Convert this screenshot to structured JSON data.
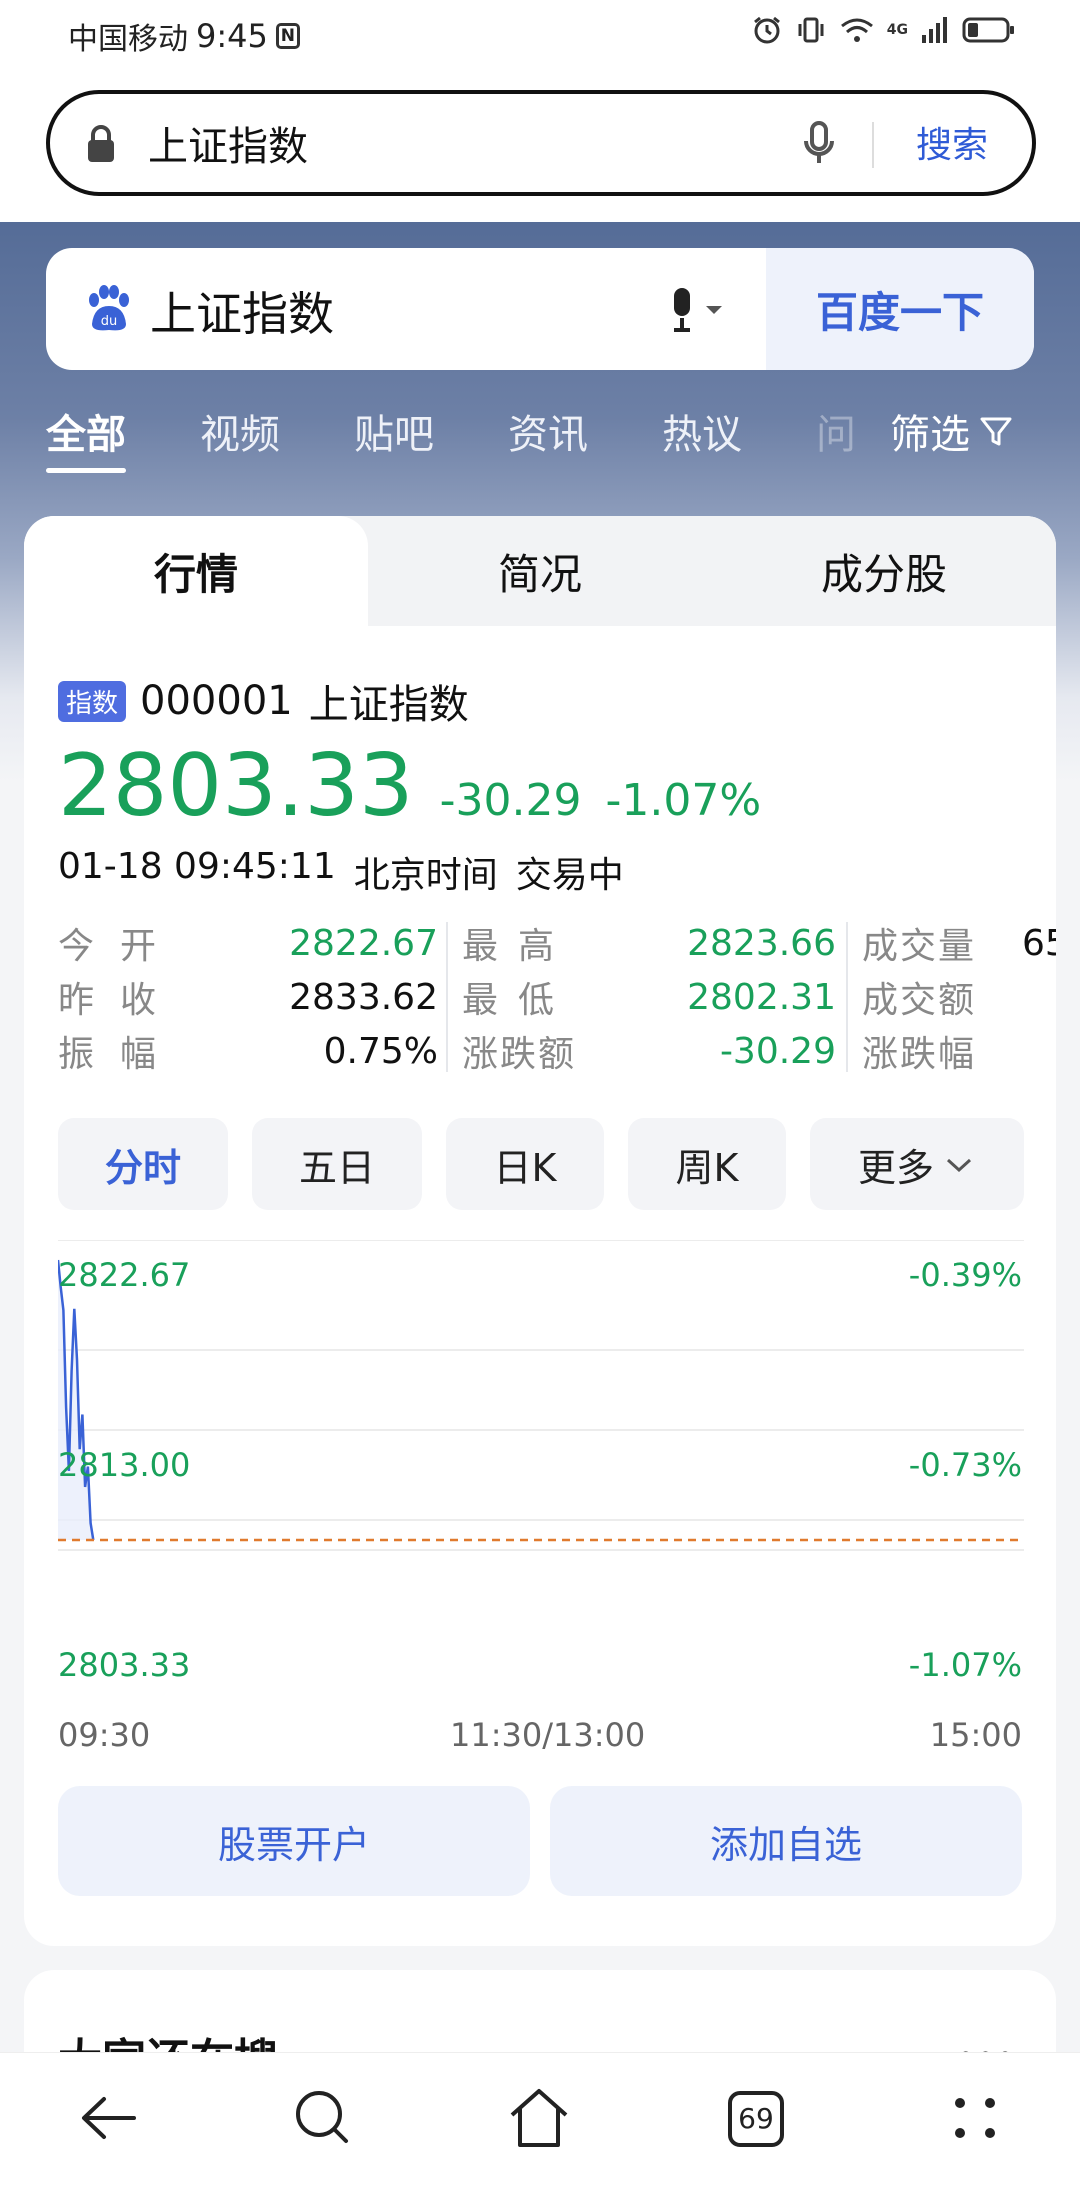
{
  "status_bar": {
    "carrier": "中国移动",
    "time": "9:45",
    "nfc": "N",
    "network": "4G"
  },
  "address_bar": {
    "query": "上证指数",
    "search_label": "搜索"
  },
  "baidu_search": {
    "query": "上证指数",
    "button_label": "百度一下"
  },
  "nav_tabs": [
    {
      "label": "全部",
      "active": true
    },
    {
      "label": "视频"
    },
    {
      "label": "贴吧"
    },
    {
      "label": "资讯"
    },
    {
      "label": "热议"
    },
    {
      "label": "问"
    }
  ],
  "filter_label": "筛选",
  "card_tabs": [
    "行情",
    "简况",
    "成分股"
  ],
  "stock": {
    "badge": "指数",
    "code": "000001",
    "name": "上证指数",
    "price": "2803.33",
    "change": "-30.29",
    "change_pct": "-1.07%",
    "date_time": "01-18 09:45:11",
    "timezone": "北京时间",
    "status": "交易中"
  },
  "stats": {
    "col1": [
      {
        "label": "今开",
        "value": "2822.67",
        "green": true
      },
      {
        "label": "昨收",
        "value": "2833.62",
        "green": false
      },
      {
        "label": "振幅",
        "value": "0.75%",
        "green": false
      }
    ],
    "col2": [
      {
        "label": "最高",
        "value": "2823.66",
        "green": true
      },
      {
        "label": "最低",
        "value": "2802.31",
        "green": true
      },
      {
        "label": "涨跌额",
        "value": "-30.29",
        "green": true
      }
    ],
    "col3": [
      {
        "label": "成交量",
        "value": "65"
      },
      {
        "label": "成交额",
        "value": ""
      },
      {
        "label": "涨跌幅",
        "value": ""
      }
    ]
  },
  "period_tabs": [
    {
      "label": "分时",
      "active": true
    },
    {
      "label": "五日"
    },
    {
      "label": "日K"
    },
    {
      "label": "周K"
    },
    {
      "label": "更多"
    }
  ],
  "chart_data": {
    "type": "line",
    "y_left_labels": [
      "2822.67",
      "2813.00",
      "2803.33"
    ],
    "y_right_labels": [
      "-0.39%",
      "-0.73%",
      "-1.07%"
    ],
    "x_labels": [
      "09:30",
      "11:30/13:00",
      "15:00"
    ],
    "ylim": [
      2803.33,
      2822.67
    ],
    "reference_value": 2803.33,
    "series": [
      {
        "values": [
          2822.67,
          2820.8,
          2819.2,
          2812.5,
          2808.1,
          2815.0,
          2819.3,
          2815.8,
          2809.6,
          2812.0,
          2807.0,
          2808.4,
          2804.5,
          2803.33
        ]
      }
    ],
    "colors": {
      "line": "#3a62d6",
      "fill": "#e8eefb",
      "reference": "#e07a2e",
      "axis_text": "#19a05a"
    }
  },
  "actions": {
    "open_account": "股票开户",
    "add_watchlist": "添加自选"
  },
  "next_section_title": "大家还在搜",
  "next_section_more": "•••",
  "bottom_nav": {
    "tab_count": "69"
  }
}
